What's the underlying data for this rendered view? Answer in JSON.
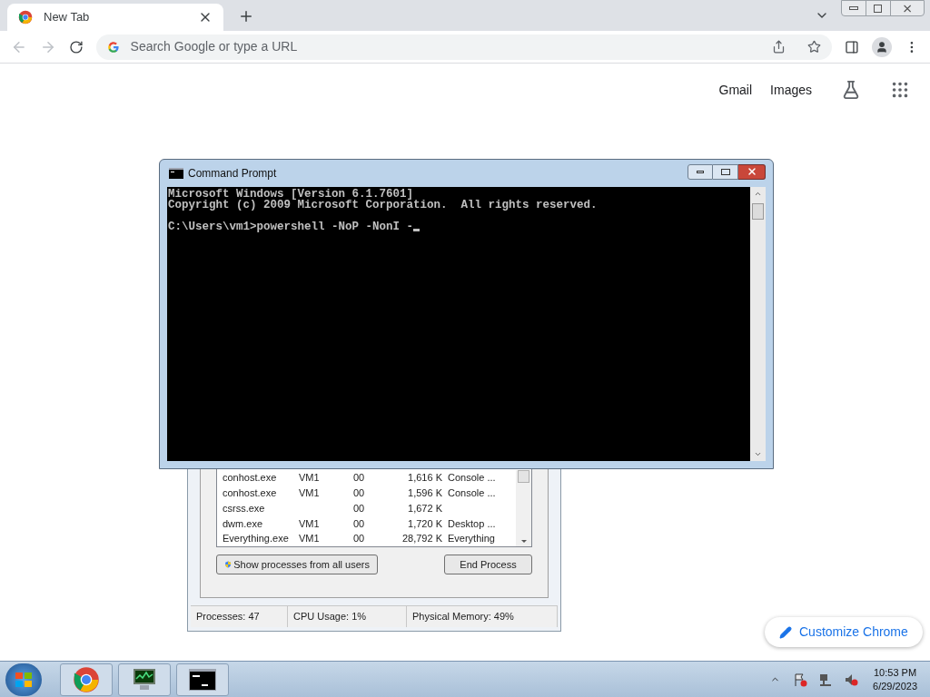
{
  "browser": {
    "tab": {
      "title": "New Tab"
    },
    "address_bar": {
      "placeholder": "Search Google or type a URL"
    },
    "links": [
      "Gmail",
      "Images"
    ],
    "customize_button": "Customize Chrome"
  },
  "task_manager": {
    "rows": [
      {
        "name": "conhost.exe",
        "user": "VM1",
        "cpu": "00",
        "memory": "1,616 K",
        "description": "Console ..."
      },
      {
        "name": "conhost.exe",
        "user": "VM1",
        "cpu": "00",
        "memory": "1,596 K",
        "description": "Console ..."
      },
      {
        "name": "csrss.exe",
        "cpu": "00",
        "memory": "1,672 K"
      },
      {
        "name": "dwm.exe",
        "user": "VM1",
        "cpu": "00",
        "memory": "1,720 K",
        "description": "Desktop ..."
      },
      {
        "name": "Everything.exe",
        "user": "VM1",
        "cpu": "00",
        "memory": "28,792 K",
        "description": "Everything"
      }
    ],
    "show_all_button": "Show processes from all users",
    "end_button": "End Process",
    "status": [
      "Processes: 47",
      "CPU Usage: 1%",
      "Physical Memory: 49%"
    ]
  },
  "console": {
    "title": "Command Prompt",
    "lines": [
      "Microsoft Windows [Version 6.1.7601]",
      "Copyright (c) 2009 Microsoft Corporation.  All rights reserved."
    ],
    "prompt": "C:\\Users\\vm1>powershell -NoP -NonI -"
  },
  "taskbar": {
    "apps": [
      {
        "kind": "chrome"
      },
      {
        "kind": "monitor"
      },
      {
        "kind": "console"
      }
    ],
    "time": "10:53 PM",
    "date": "6/29/2023"
  }
}
